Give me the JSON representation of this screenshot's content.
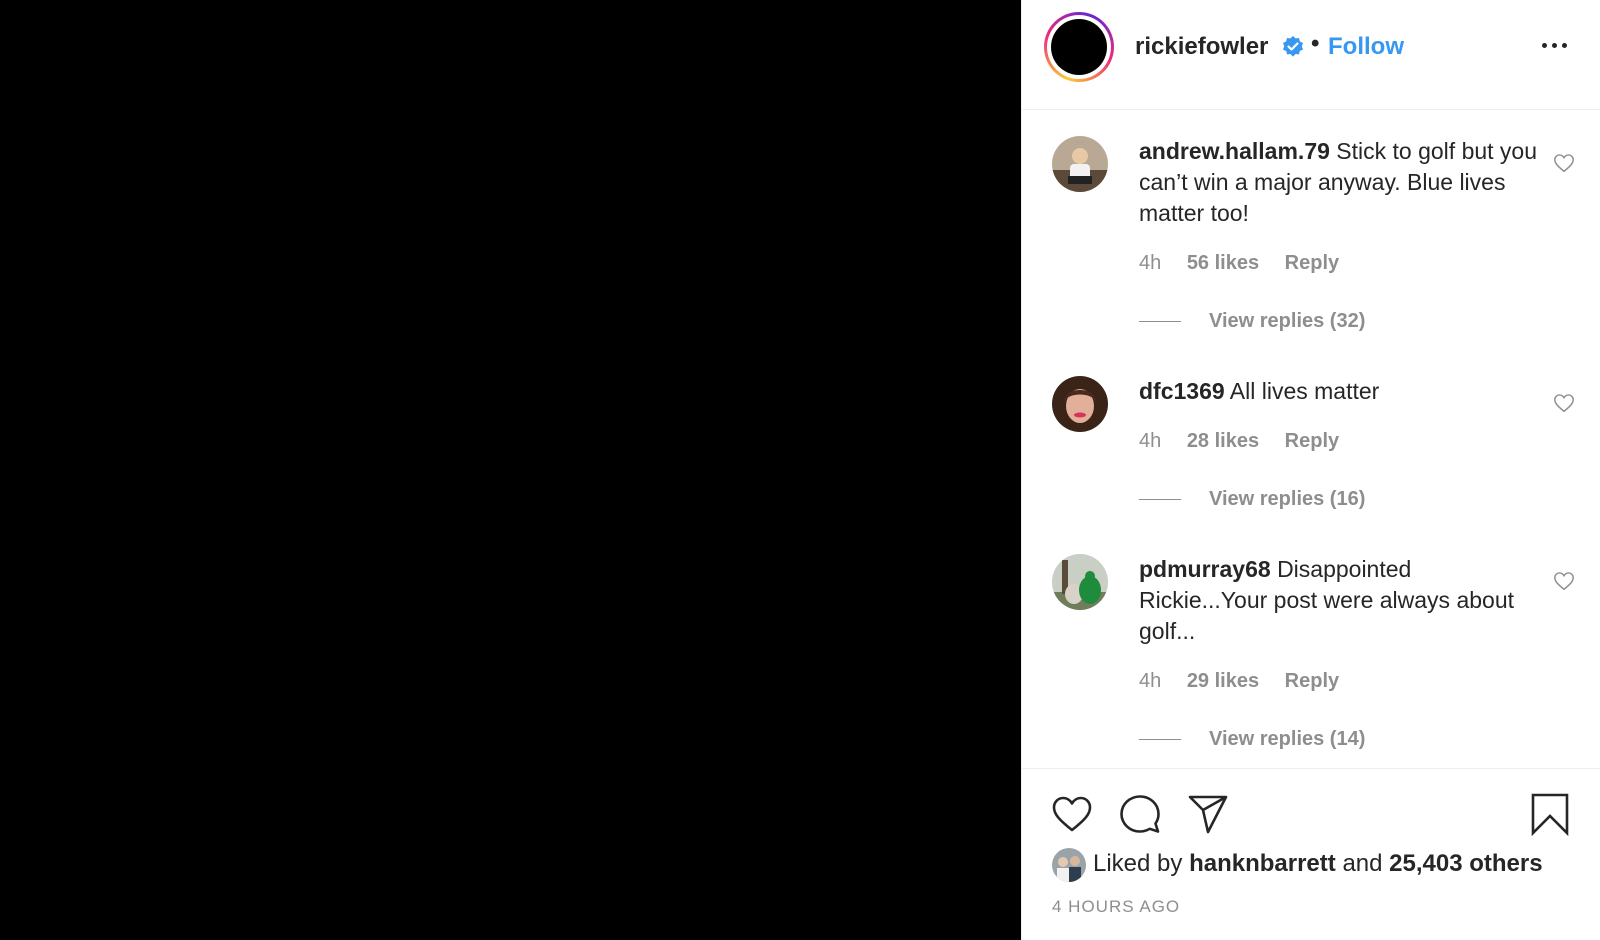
{
  "post": {
    "username": "rickiefowler",
    "separator": "•",
    "follow_label": "Follow"
  },
  "comments": [
    {
      "username": "andrew.hallam.79",
      "text": "Stick to golf but you can’t win a major anyway. Blue lives matter too!",
      "time": "4h",
      "likes": "56 likes",
      "reply_label": "Reply",
      "view_replies": "View replies (32)"
    },
    {
      "username": "dfc1369",
      "text": "All lives matter",
      "time": "4h",
      "likes": "28 likes",
      "reply_label": "Reply",
      "view_replies": "View replies (16)"
    },
    {
      "username": "pdmurray68",
      "text": "Disappointed Rickie...Your post were always about golf...",
      "time": "4h",
      "likes": "29 likes",
      "reply_label": "Reply",
      "view_replies": "View replies (14)"
    }
  ],
  "likes": {
    "prefix": "Liked by",
    "user": "hanknbarrett",
    "middle": "and",
    "others": "25,403 others"
  },
  "timestamp": "4 HOURS AGO",
  "icons": [
    "verified-badge-icon",
    "more-options-icon",
    "heart-icon",
    "comment-icon",
    "share-icon",
    "bookmark-icon"
  ],
  "colors": {
    "accent": "#3897f0",
    "muted": "#8e8e8e",
    "text": "#262626",
    "media_bg": "#000000"
  }
}
